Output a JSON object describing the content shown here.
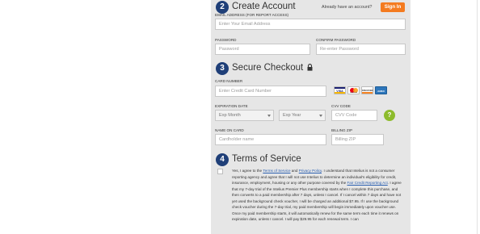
{
  "create_account": {
    "step": "2",
    "title": "Create Account",
    "already_text": "Already have an account?",
    "signin_label": "Sign In",
    "email_label": "EMAIL ADDRESS (FOR REPORT ACCESS)",
    "email_placeholder": "Enter Your Email Address",
    "password_label": "PASSWORD",
    "password_placeholder": "Password",
    "confirm_label": "CONFIRM PASSWORD",
    "confirm_placeholder": "Re-enter Password"
  },
  "checkout": {
    "step": "3",
    "title": "Secure Checkout",
    "lock_icon": "lock-icon",
    "card_number_label": "CARD NUMBER",
    "card_number_placeholder": "Enter Credit Card Number",
    "card_brands": [
      "VISA",
      "mastercard",
      "DISCOVER",
      "AMEX"
    ],
    "expiration_label": "EXPIRATION DATE",
    "exp_month_value": "Exp Month",
    "exp_year_value": "Exp Year",
    "cvv_label": "CVV CODE",
    "cvv_placeholder": "CVV Code",
    "help_symbol": "?",
    "name_label": "NAME ON CARD",
    "name_placeholder": "Cardholder name",
    "zip_label": "BILLING ZIP",
    "zip_placeholder": "Billing ZIP"
  },
  "terms": {
    "step": "4",
    "title": "Terms of Service",
    "t1": "Yes, I agree to the ",
    "link_terms": "Terms of Service",
    "t2": " and ",
    "link_privacy": "Privacy Policy",
    "t3": ". I understand that Intelius is not a consumer reporting agency and agree that I will not use Intelius to determine an individual's eligibility for credit, insurance, employment, housing or any other purpose covered by the ",
    "link_fcra": "Fair Credit Reporting Act",
    "t4": ". I agree that my 7-day trial of the Intelius Premier Plus membership starts when I complete this purchase, and then converts to a paid membership after 7 days, unless I cancel. If I cancel within 7 days and have not yet used the background check voucher, I will be charged an additional $7.95. If I use the background check voucher during the 7-day trial, my paid membership will begin immediately upon voucher use. Once my paid membership starts, it will automatically renew for the same term each time it renews on expiration date, unless I cancel. I will pay $29.95 for each renewal term. I can"
  },
  "colors": {
    "panel_bg": "#e6e6e6",
    "step_badge": "#1f3f78",
    "signin_button": "#f47b20",
    "help_button": "#8dbb2c",
    "link": "#2a5fb0"
  }
}
